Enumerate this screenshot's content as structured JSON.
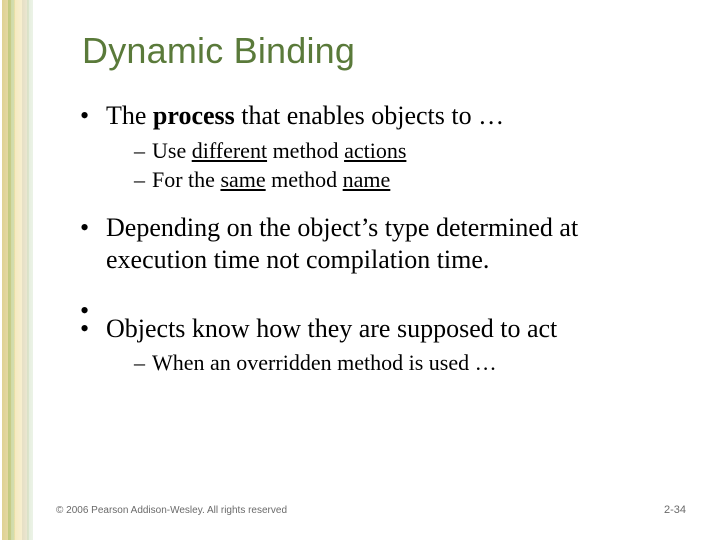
{
  "title": "Dynamic Binding",
  "bullets": {
    "b1": {
      "pre": "The ",
      "strong": "process",
      "post": " that enables objects to …",
      "sub": [
        {
          "pre": "Use ",
          "u1": "different",
          "mid": " method ",
          "u2": "actions",
          "post": ""
        },
        {
          "pre": "For the ",
          "u1": "same",
          "mid": " method ",
          "u2": "name",
          "post": ""
        }
      ]
    },
    "b2": {
      "text": "Depending on the object’s type determined at execution time not compilation time."
    },
    "b3": {
      "text": "Objects know how they are supposed to act",
      "sub": [
        {
          "text": "When an overridden method is used …"
        }
      ]
    }
  },
  "footer": {
    "copyright": "© 2006 Pearson Addison-Wesley. All rights reserved",
    "page": "2-34"
  }
}
